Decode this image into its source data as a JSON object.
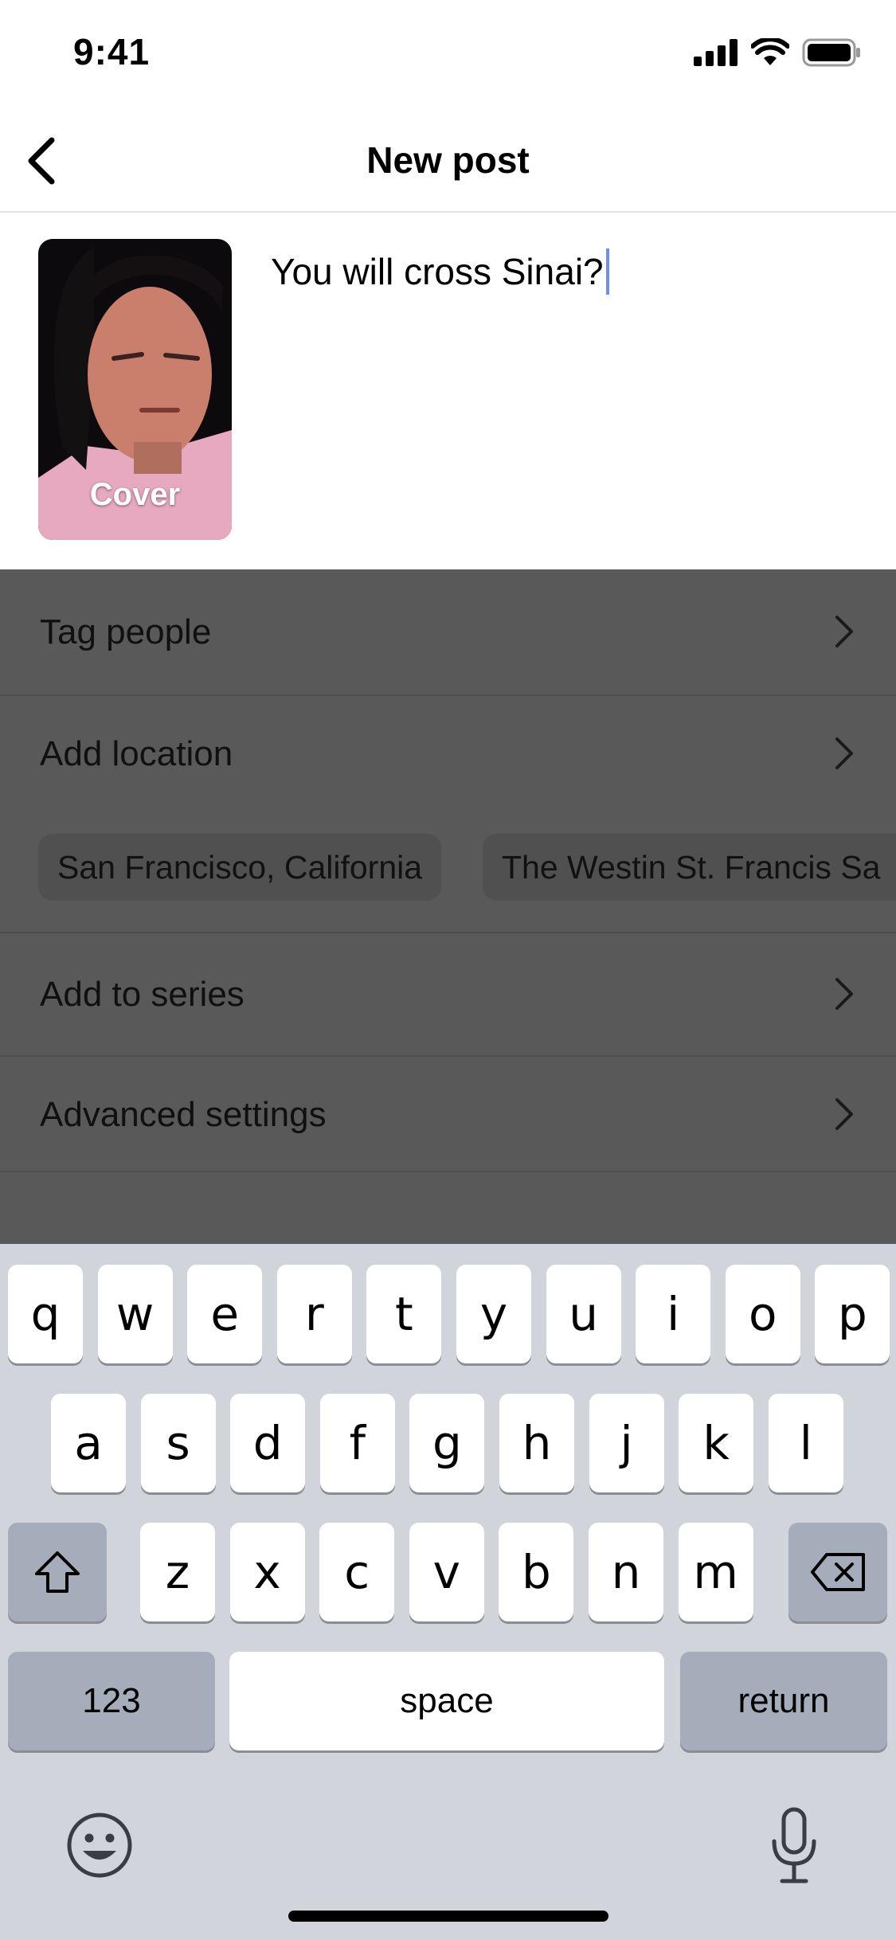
{
  "status_bar": {
    "time": "9:41"
  },
  "header": {
    "title": "New post"
  },
  "compose": {
    "cover_label": "Cover",
    "caption": "You will cross Sinai?"
  },
  "options": {
    "tag_people": "Tag people",
    "add_location": "Add location",
    "location_suggestions": [
      "San Francisco, California",
      "The Westin St. Francis Sa"
    ],
    "add_to_series": "Add to series",
    "advanced_settings": "Advanced settings"
  },
  "keyboard": {
    "row1": [
      "q",
      "w",
      "e",
      "r",
      "t",
      "y",
      "u",
      "i",
      "o",
      "p"
    ],
    "row2": [
      "a",
      "s",
      "d",
      "f",
      "g",
      "h",
      "j",
      "k",
      "l"
    ],
    "row3": [
      "z",
      "x",
      "c",
      "v",
      "b",
      "n",
      "m"
    ],
    "numbers_label": "123",
    "space_label": "space",
    "return_label": "return"
  }
}
